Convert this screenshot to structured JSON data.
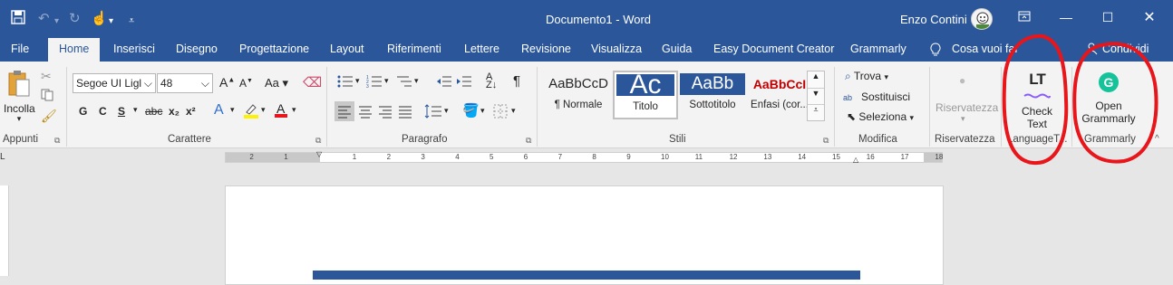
{
  "titlebar": {
    "document_title": "Documento1  -  Word",
    "user_name": "Enzo Contini",
    "icons": [
      "save-icon",
      "undo-icon",
      "redo-icon",
      "touch-mode-icon",
      "customize-qat-icon"
    ]
  },
  "menu": {
    "tabs": [
      "File",
      "Home",
      "Inserisci",
      "Disegno",
      "Progettazione",
      "Layout",
      "Riferimenti",
      "Lettere",
      "Revisione",
      "Visualizza",
      "Guida",
      "Easy Document Creator",
      "Grammarly"
    ],
    "active_tab": "Home",
    "tell_me": "Cosa vuoi far",
    "share": "Condividi"
  },
  "ribbon": {
    "clipboard": {
      "paste": "Incolla",
      "label": "Appunti"
    },
    "font": {
      "name": "Segoe UI Ligl",
      "size": "48",
      "case": "Aa",
      "bold": "G",
      "italic": "C",
      "underline": "S",
      "strike": "abc",
      "sub": "x₂",
      "sup": "x²",
      "label": "Carattere"
    },
    "paragraph": {
      "label": "Paragrafo"
    },
    "styles": {
      "items": [
        {
          "sample": "AaBbCcD",
          "name": "¶ Normale"
        },
        {
          "sample": "Ac",
          "name": "Titolo"
        },
        {
          "sample": "AaBb",
          "name": "Sottotitolo"
        },
        {
          "sample": "AaBbCcI",
          "name": "Enfasi (cor..."
        }
      ],
      "label": "Stili"
    },
    "editing": {
      "find": "Trova",
      "replace": "Sostituisci",
      "select": "Seleziona",
      "label": "Modifica"
    },
    "privacy": {
      "button": "Riservatezza",
      "label": "Riservatezza"
    },
    "languagetool": {
      "logo": "LT",
      "button_line1": "Check",
      "button_line2": "Text",
      "label": "LanguageT..."
    },
    "grammarly": {
      "logo": "G",
      "button_line1": "Open",
      "button_line2": "Grammarly",
      "label": "Grammarly",
      "accent": "#15c39a"
    }
  },
  "ruler": {
    "labels": [
      "2",
      "1",
      "1",
      "2",
      "3",
      "4",
      "5",
      "6",
      "7",
      "8",
      "9",
      "10",
      "11",
      "12",
      "13",
      "14",
      "15",
      "16",
      "17",
      "18"
    ]
  },
  "colors": {
    "word_blue": "#2b579a",
    "annotation_red": "#e8151b"
  }
}
